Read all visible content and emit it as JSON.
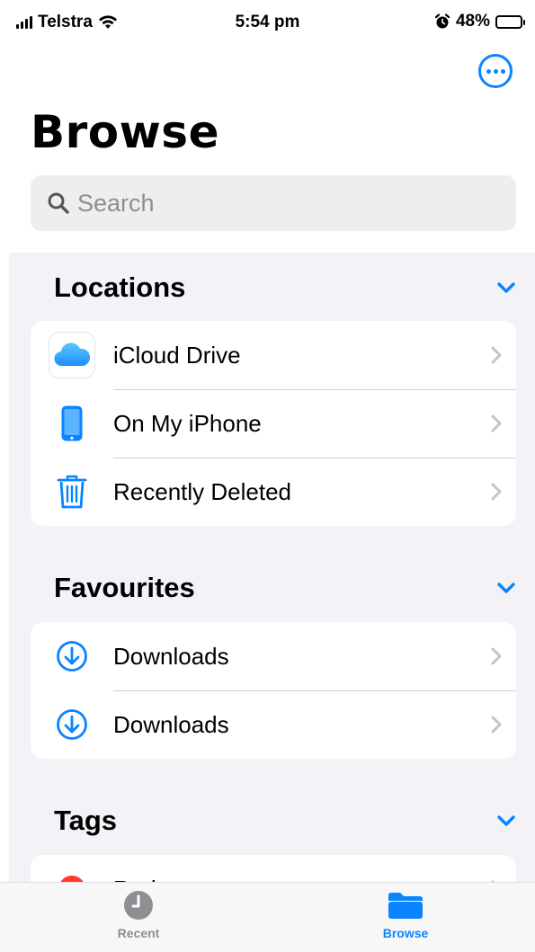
{
  "status_bar": {
    "carrier": "Telstra",
    "time": "5:54 pm",
    "battery": "48%"
  },
  "header": {
    "title": "Browse",
    "more_icon": "ellipsis-circle-icon"
  },
  "search": {
    "placeholder": "Search"
  },
  "sections": {
    "locations": {
      "title": "Locations",
      "items": [
        {
          "label": "iCloud Drive",
          "icon": "icloud-icon"
        },
        {
          "label": "On My iPhone",
          "icon": "iphone-icon"
        },
        {
          "label": "Recently Deleted",
          "icon": "trash-icon"
        }
      ]
    },
    "favourites": {
      "title": "Favourites",
      "items": [
        {
          "label": "Downloads",
          "icon": "download-circle-icon"
        },
        {
          "label": "Downloads",
          "icon": "download-circle-icon"
        }
      ]
    },
    "tags": {
      "title": "Tags",
      "items": [
        {
          "label": "Red",
          "color": "#ff3b30"
        }
      ]
    }
  },
  "tab_bar": {
    "tabs": [
      {
        "label": "Recent",
        "icon": "clock-icon",
        "active": false
      },
      {
        "label": "Browse",
        "icon": "folder-icon",
        "active": true
      }
    ]
  },
  "colors": {
    "accent": "#0a84ff",
    "inactive": "#8e8e93",
    "grouped_bg": "#f2f2f7"
  }
}
